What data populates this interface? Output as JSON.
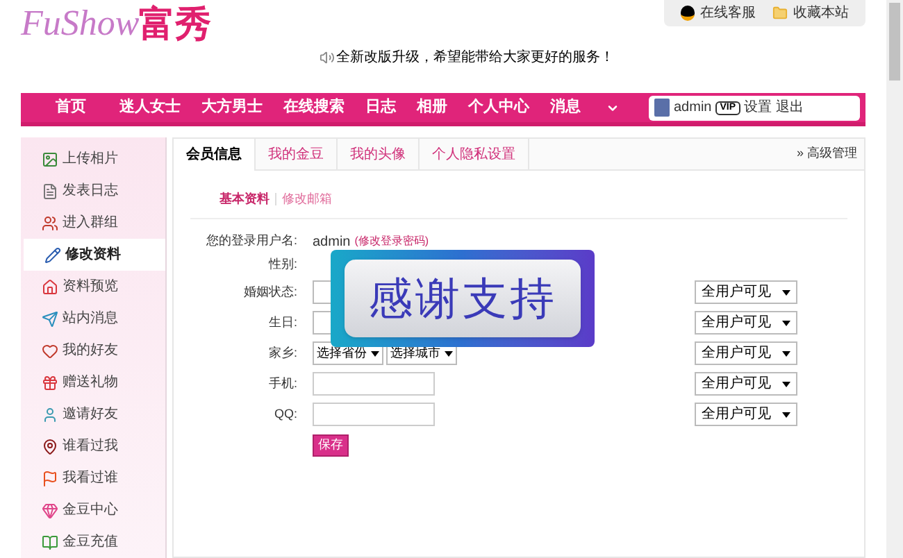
{
  "logo": {
    "latin": "FuShow",
    "chinese": "富秀"
  },
  "top_links": [
    {
      "label": "在线客服",
      "kind": "qq"
    },
    {
      "label": "收藏本站",
      "kind": "folder"
    }
  ],
  "notice": "全新改版升级，希望能带给大家更好的服务！",
  "nav": {
    "items": [
      "首页",
      "迷人女士",
      "大方男士",
      "在线搜索",
      "日志",
      "相册",
      "个人中心",
      "消息"
    ],
    "user": {
      "name": "admin",
      "badge": "VIP",
      "links": [
        "设置",
        "退出"
      ]
    }
  },
  "sidebar": {
    "items": [
      {
        "label": "上传相片",
        "selected": false
      },
      {
        "label": "发表日志",
        "selected": false
      },
      {
        "label": "进入群组",
        "selected": false
      },
      {
        "label": "修改资料",
        "selected": true
      },
      {
        "label": "资料预览",
        "selected": false
      },
      {
        "label": "站内消息",
        "selected": false
      },
      {
        "label": "我的好友",
        "selected": false
      },
      {
        "label": "赠送礼物",
        "selected": false
      },
      {
        "label": "邀请好友",
        "selected": false
      },
      {
        "label": "谁看过我",
        "selected": false
      },
      {
        "label": "我看过谁",
        "selected": false
      },
      {
        "label": "金豆中心",
        "selected": false
      },
      {
        "label": "金豆充值",
        "selected": false
      }
    ]
  },
  "tabs": [
    {
      "label": "会员信息",
      "selected": true
    },
    {
      "label": "我的金豆",
      "selected": false
    },
    {
      "label": "我的头像",
      "selected": false
    },
    {
      "label": "个人隐私设置",
      "selected": false
    }
  ],
  "advanced_link": "» 高级管理",
  "subtabs": [
    {
      "label": "基本资料",
      "selected": true
    },
    {
      "label": "修改邮箱",
      "selected": false
    }
  ],
  "form": {
    "rows": [
      {
        "label": "您的登录用户名:",
        "kind": "text",
        "value": "admin",
        "link": "(修改登录密码)"
      },
      {
        "label": "性别:",
        "kind": "text"
      },
      {
        "label": "婚姻状态:",
        "kind": "select",
        "privacy": "全用户可见"
      },
      {
        "label": "生日:",
        "kind": "select",
        "privacy": "全用户可见"
      },
      {
        "label": "家乡:",
        "kind": "double_select",
        "options": [
          "选择省份",
          "选择城市"
        ],
        "privacy": "全用户可见"
      },
      {
        "label": "手机:",
        "kind": "input",
        "privacy": "全用户可见"
      },
      {
        "label": "QQ:",
        "kind": "input",
        "privacy": "全用户可见"
      }
    ],
    "save": "保存"
  },
  "overlay": "感谢支持"
}
